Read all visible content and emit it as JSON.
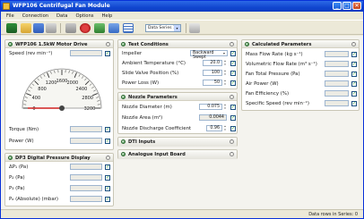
{
  "window": {
    "title": "WFP106 Centrifugal Fan Module",
    "controls": [
      "_",
      "□",
      "✕"
    ]
  },
  "menu": [
    "File",
    "Connection",
    "Data",
    "Options",
    "Help"
  ],
  "toolbar": {
    "icons": [
      "logo-icon",
      "open-icon",
      "save-icon",
      "print-icon",
      "tools-icon",
      "record-icon",
      "chart-icon",
      "table-icon"
    ],
    "series_select": "Data Series 1",
    "colors": {
      "accent": "#1147d0",
      "green": "#4f9a55"
    }
  },
  "motor_drive": {
    "title": "WFP106 1.5kW Motor Drive",
    "speed": {
      "label": "Speed (rev min⁻¹)",
      "value": ""
    },
    "gauge": {
      "ticks": [
        "0",
        "400",
        "800",
        "1200",
        "1600",
        "2000",
        "2400",
        "2800",
        "3200"
      ],
      "min": 0,
      "max": 3200,
      "value": 0
    },
    "torque": {
      "label": "Torque (Nm)",
      "value": ""
    },
    "power": {
      "label": "Power (W)",
      "value": ""
    }
  },
  "dp3": {
    "title": "DP3 Digital Pressure Display",
    "rows": [
      {
        "label": "ΔP₁ (Pa)",
        "value": ""
      },
      {
        "label": "P₂ (Pa)",
        "value": ""
      },
      {
        "label": "P₃ (Pa)",
        "value": ""
      },
      {
        "label": "Pₐ (Absolute) (mbar)",
        "value": ""
      }
    ]
  },
  "test_conditions": {
    "title": "Test Conditions",
    "impeller": {
      "label": "Impeller",
      "value": "Backward Swept"
    },
    "rows": [
      {
        "label": "Ambient Temperature (°C)",
        "value": "20.0"
      },
      {
        "label": "Slide Valve Position (%)",
        "value": "100"
      },
      {
        "label": "Power Loss (W)",
        "value": "50"
      }
    ]
  },
  "nozzle": {
    "title": "Nozzle Parameters",
    "rows": [
      {
        "label": "Nozzle Diameter (m)",
        "value": "0.075"
      },
      {
        "label": "Nozzle Area (m²)",
        "value": "0.0044"
      },
      {
        "label": "Nozzle Discharge Coefficient",
        "value": "0.96"
      }
    ]
  },
  "dti": {
    "title": "DTI Inputs"
  },
  "analogue": {
    "title": "Analogue Input Board"
  },
  "calculated": {
    "title": "Calculated Parameters",
    "rows": [
      {
        "label": "Mass Flow Rate (kg s⁻¹)",
        "value": ""
      },
      {
        "label": "Volumetric Flow Rate (m³ s⁻¹)",
        "value": ""
      },
      {
        "label": "Fan Total Pressure (Pa)",
        "value": ""
      },
      {
        "label": "Air Power (W)",
        "value": ""
      },
      {
        "label": "Fan Efficiency (%)",
        "value": ""
      },
      {
        "label": "Specific Speed (rev min⁻¹)",
        "value": ""
      }
    ]
  },
  "status": {
    "text": "Data rows in Series: 0"
  }
}
